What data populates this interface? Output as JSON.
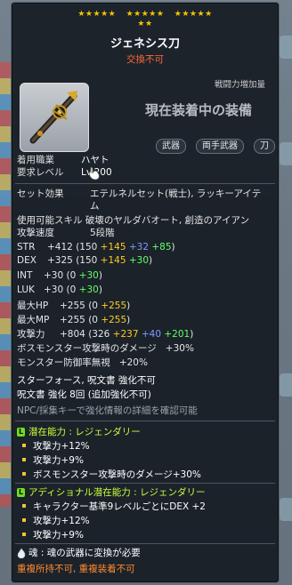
{
  "stars": {
    "group1": "★★★★★",
    "group2": "★★★★★",
    "group3": "★★★★★",
    "group4": "★★"
  },
  "item": {
    "name": "ジェネシス刀",
    "trade": "交換不可"
  },
  "panel": {
    "cp_label": "戦闘力増加量",
    "equipped_msg": "現在装着中の装備",
    "tags": [
      "武器",
      "両手武器",
      "刀"
    ]
  },
  "req": {
    "job_label": "着用職業",
    "job_value": "ハヤト",
    "level_label": "要求レベル",
    "level_value": "Lv.200"
  },
  "set": {
    "label": "セット効果",
    "line1": "エテルネルセット(戦士), ラッキーアイテ",
    "line2": "ム"
  },
  "skill_line": "使用可能スキル 破壊のヤルダバオート, 創造のアイアン",
  "speed": {
    "label": "攻撃速度",
    "value": "5段階"
  },
  "stats": [
    {
      "label": "STR",
      "total": "+412",
      "open": "(150",
      "a": "+145",
      "b": "+32",
      "c": "+85",
      "close": ")"
    },
    {
      "label": "DEX",
      "total": "+325",
      "open": "(150",
      "a": "+145",
      "b": "",
      "c": "+30",
      "close": ")"
    },
    {
      "label": "INT",
      "total": "+30",
      "open": "(0",
      "a": "",
      "b": "",
      "c": "+30",
      "close": ")"
    },
    {
      "label": "LUK",
      "total": "+30",
      "open": "(0",
      "a": "",
      "b": "",
      "c": "+30",
      "close": ")"
    },
    {
      "label": "最大HP",
      "total": "+255",
      "open": "(0",
      "a": "+255",
      "b": "",
      "c": "",
      "close": ")"
    },
    {
      "label": "最大MP",
      "total": "+255",
      "open": "(0",
      "a": "+255",
      "b": "",
      "c": "",
      "close": ")"
    },
    {
      "label": "攻撃力",
      "total": "+804",
      "open": "(326",
      "a": "+237",
      "b": "+40",
      "c": "+201",
      "close": ")"
    }
  ],
  "extra": {
    "boss": "ボスモンスター攻撃時のダメージ",
    "boss_val": "+30%",
    "ignore": "モンスター防御率無視",
    "ignore_val": "+20%"
  },
  "enhance": {
    "line1": "スターフォース, 呪文書 強化不可",
    "line2": "呪文書 強化 8回 (追加強化不可)",
    "npc": "NPC/採集キーで強化情報の詳細を確認可能"
  },
  "potential": {
    "badge": "L",
    "title": "潜在能力 : レジェンダリー",
    "lines": [
      "攻撃力+12%",
      "攻撃力+9%",
      "ボスモンスター攻撃時のダメージ+30%"
    ]
  },
  "additional": {
    "badge": "L",
    "title": "アディショナル潜在能力 : レジェンダリー",
    "lines": [
      "キャラクター基準9レベルごとにDEX +2",
      "攻撃力+12%",
      "攻撃力+9%"
    ]
  },
  "soul": "魂 : 魂の武器に変換が必要",
  "footer": "重複所持不可, 重複装着不可",
  "colors": {
    "base": "#e6e6e6",
    "item_bonus": "#ffcc22",
    "scroll_bonus": "#7f9cff",
    "flame_bonus": "#66ff66",
    "trade": "#ff6a3a",
    "legendary": "#c8ff3a"
  }
}
